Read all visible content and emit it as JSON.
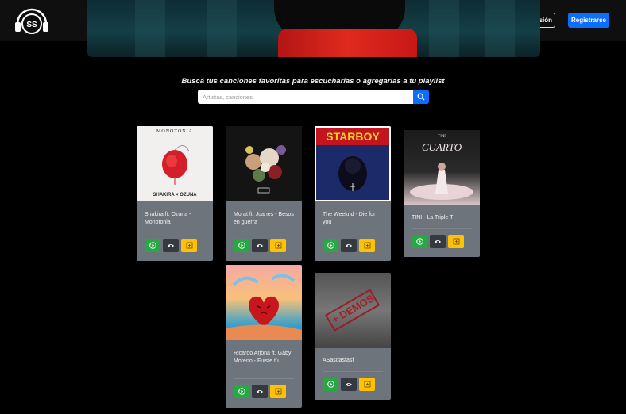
{
  "nav": {
    "login_label": "Iniciar sesión",
    "register_label": "Registrarse",
    "logo_icon": "headphones-logo-icon"
  },
  "main": {
    "tagline": "Buscá tus canciones favoritas para escucharlas o agregarlas a tu playlist",
    "search_placeholder": "Artistas, canciones",
    "search_icon": "search-icon"
  },
  "cards": [
    {
      "title": "Shakira ft. Ozuna - Monotonia",
      "cover_text_top": "MONOTONIA",
      "cover_text_bottom": "SHAKIRA × OZUNA"
    },
    {
      "title": "Morat ft. Juanes - Besos en guerra",
      "cover_text_top": "",
      "cover_text_bottom": ""
    },
    {
      "title": "The Weeknd - Die for you",
      "cover_text_top": "STARBOY",
      "cover_text_bottom": ""
    },
    {
      "title": "TINI - La Triple T",
      "cover_text_top": "TINI",
      "cover_text_bottom": "CUARTO"
    },
    {
      "title": "Ricardo Arjona ft. Gaby Moreno - Fuiste tú",
      "cover_text_top": "",
      "cover_text_bottom": ""
    },
    {
      "title": "ASasdasfasf",
      "cover_text_top": "+ DEMOS",
      "cover_text_bottom": ""
    }
  ],
  "colors": {
    "primary": "#0d6efd",
    "play": "#28a745",
    "view": "#343a40",
    "add": "#ffc107",
    "card": "#6d747c"
  },
  "icons": [
    "play-icon",
    "eye-icon",
    "add-to-playlist-icon"
  ]
}
